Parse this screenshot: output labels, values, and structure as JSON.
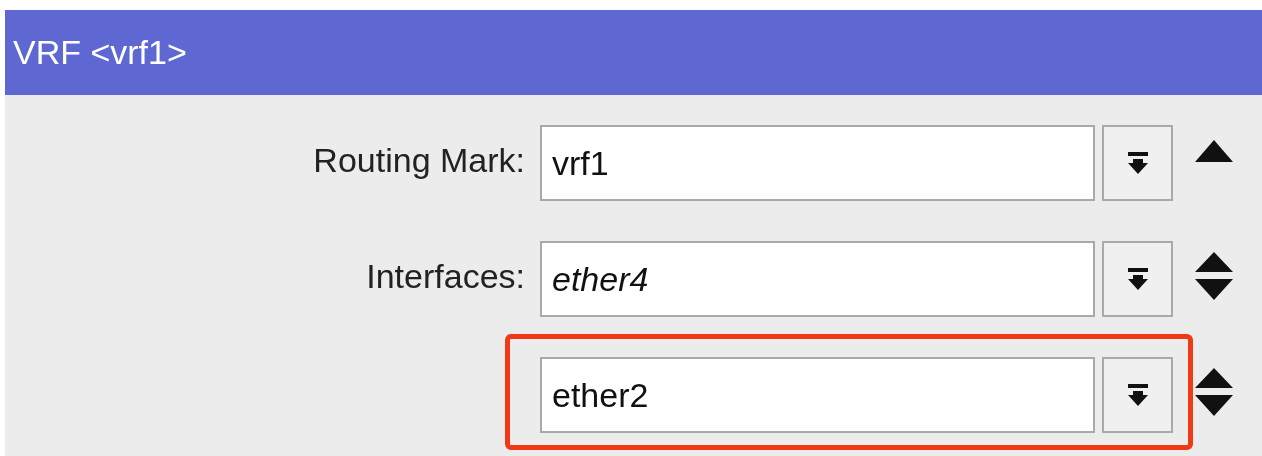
{
  "window": {
    "title": "VRF <vrf1>"
  },
  "fields": [
    {
      "label": "Routing Mark:",
      "value": "vrf1",
      "italic": false,
      "highlighted": false,
      "kind": "up"
    },
    {
      "label": "Interfaces:",
      "value": "ether4",
      "italic": true,
      "highlighted": false,
      "kind": "updown"
    },
    {
      "value": "ether2",
      "italic": false,
      "highlighted": true,
      "kind": "updown"
    }
  ]
}
